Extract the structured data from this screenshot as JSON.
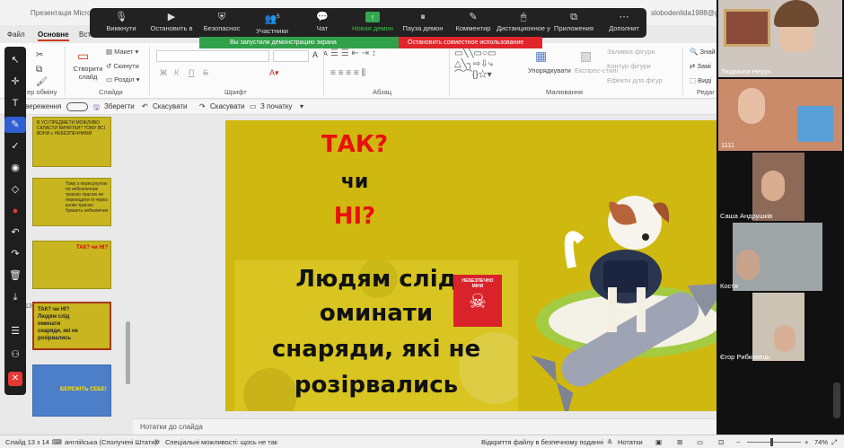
{
  "window": {
    "title": "Презентація Microsoft",
    "title_right": "slobodenlida1988@gm"
  },
  "menu": {
    "tabs": [
      "Файл",
      "Основне",
      "Встав"
    ]
  },
  "zoom_toolbar": {
    "items": [
      {
        "label": "Вимкнути",
        "icon": "microphone-icon"
      },
      {
        "label": "Остановить в",
        "icon": "video-camera-icon"
      },
      {
        "label": "Безопаснос",
        "icon": "shield-icon"
      },
      {
        "label": "Участники",
        "icon": "participants-icon",
        "count": "5"
      },
      {
        "label": "Чат",
        "icon": "chat-icon"
      },
      {
        "label": "Новая демон",
        "icon": "share-screen-icon",
        "accent": "#2fa84f"
      },
      {
        "label": "Пауза демон",
        "icon": "pause-icon"
      },
      {
        "label": "Комментир",
        "icon": "pencil-icon"
      },
      {
        "label": "Дистанционное у",
        "icon": "remote-control-icon"
      },
      {
        "label": "Приложения",
        "icon": "apps-icon"
      },
      {
        "label": "Дополнит",
        "icon": "more-icon"
      }
    ]
  },
  "share_banner": {
    "text": "Вы запустили демонстрацию экрана",
    "stop_label": "Остановить совместное использование"
  },
  "ribbon": {
    "clipboard": {
      "group": "ер обміну"
    },
    "slides": {
      "new_slide": "Створити слайд",
      "layout": "Макет",
      "reset": "Скинути",
      "section": "Розділ",
      "group": "Слайди"
    },
    "font": {
      "group": "Шрифт",
      "bold": "Ж",
      "italic": "К",
      "underline": "П",
      "strike": "S",
      "size_up": "A",
      "size_down": "A"
    },
    "paragraph": {
      "group": "Абзац"
    },
    "drawing": {
      "arrange": "Упорядкувати",
      "quick_styles": "Експрес-стилі",
      "fill": "Заливка фігури",
      "outline": "Контур фігури",
      "effects": "Ефекти для фігур",
      "group": "Малювання"
    },
    "editing": {
      "find": "Знай",
      "replace": "Замі",
      "select": "Виді",
      "group": "Редаг"
    }
  },
  "qat": {
    "autosave": "вереження",
    "save": "Зберегти",
    "undo": "Скасувати",
    "redo": "Скасувати",
    "from_start": "З початку"
  },
  "annotation_tools": [
    "pointer-icon",
    "move-icon",
    "text-icon",
    "pen-icon",
    "check-icon",
    "spotlight-icon",
    "eraser-icon",
    "color-dot-icon",
    "undo-icon",
    "redo-icon",
    "trash-icon",
    "save-icon",
    "menu-icon",
    "share-annotation-icon",
    "close-icon"
  ],
  "thumbnails": [
    {
      "num": "",
      "text": "В УСІ ПРЕДМЕТИ МОЖЛИВО СКЛАСТИ ВИНЯТКИ? ТОМУ ВСІ ВОНИ є НЕБЕЗПЕЧНИМИ"
    },
    {
      "num": "",
      "text": "Тому з пересунутою по небезпечних трасою трасою не переходити ні через колію трасою бувають небезпечно"
    },
    {
      "num": "",
      "text": "ТАК? чи НІ?"
    },
    {
      "num": "13",
      "text": "ТАК? чи НІ? Людям слід оминати снаряди, які не розірвались"
    },
    {
      "num": "",
      "text": "БЕРЕЖІТЬ СЕБЕ!"
    }
  ],
  "slide": {
    "line1": "ТАК?",
    "line2": "чи",
    "line3": "НІ?",
    "body": [
      "Людям слід",
      "оминати",
      "снаряди, які не",
      "розірвались"
    ],
    "sign": "НЕБЕЗПЕЧНО МІНИ",
    "colors": {
      "background": "#cfb80f",
      "red": "#e8100c",
      "sign": "#d9222a"
    }
  },
  "notes": {
    "placeholder": "Нотатки до слайда"
  },
  "status": {
    "slide": "Слайд 13 з 14",
    "language": "англійська (Сполучені Штати)",
    "accessibility": "Спеціальні можливості: щось не так",
    "safe_mode": "Відкриття файлу в безпечному поданні",
    "notes": "Нотатки",
    "zoom": "74%"
  },
  "participants": [
    {
      "name": "Людмила Нерух"
    },
    {
      "name": "1111"
    },
    {
      "name": "Саша Андрушків"
    },
    {
      "name": "Костя"
    },
    {
      "name": "Єгор Рибковець"
    }
  ]
}
